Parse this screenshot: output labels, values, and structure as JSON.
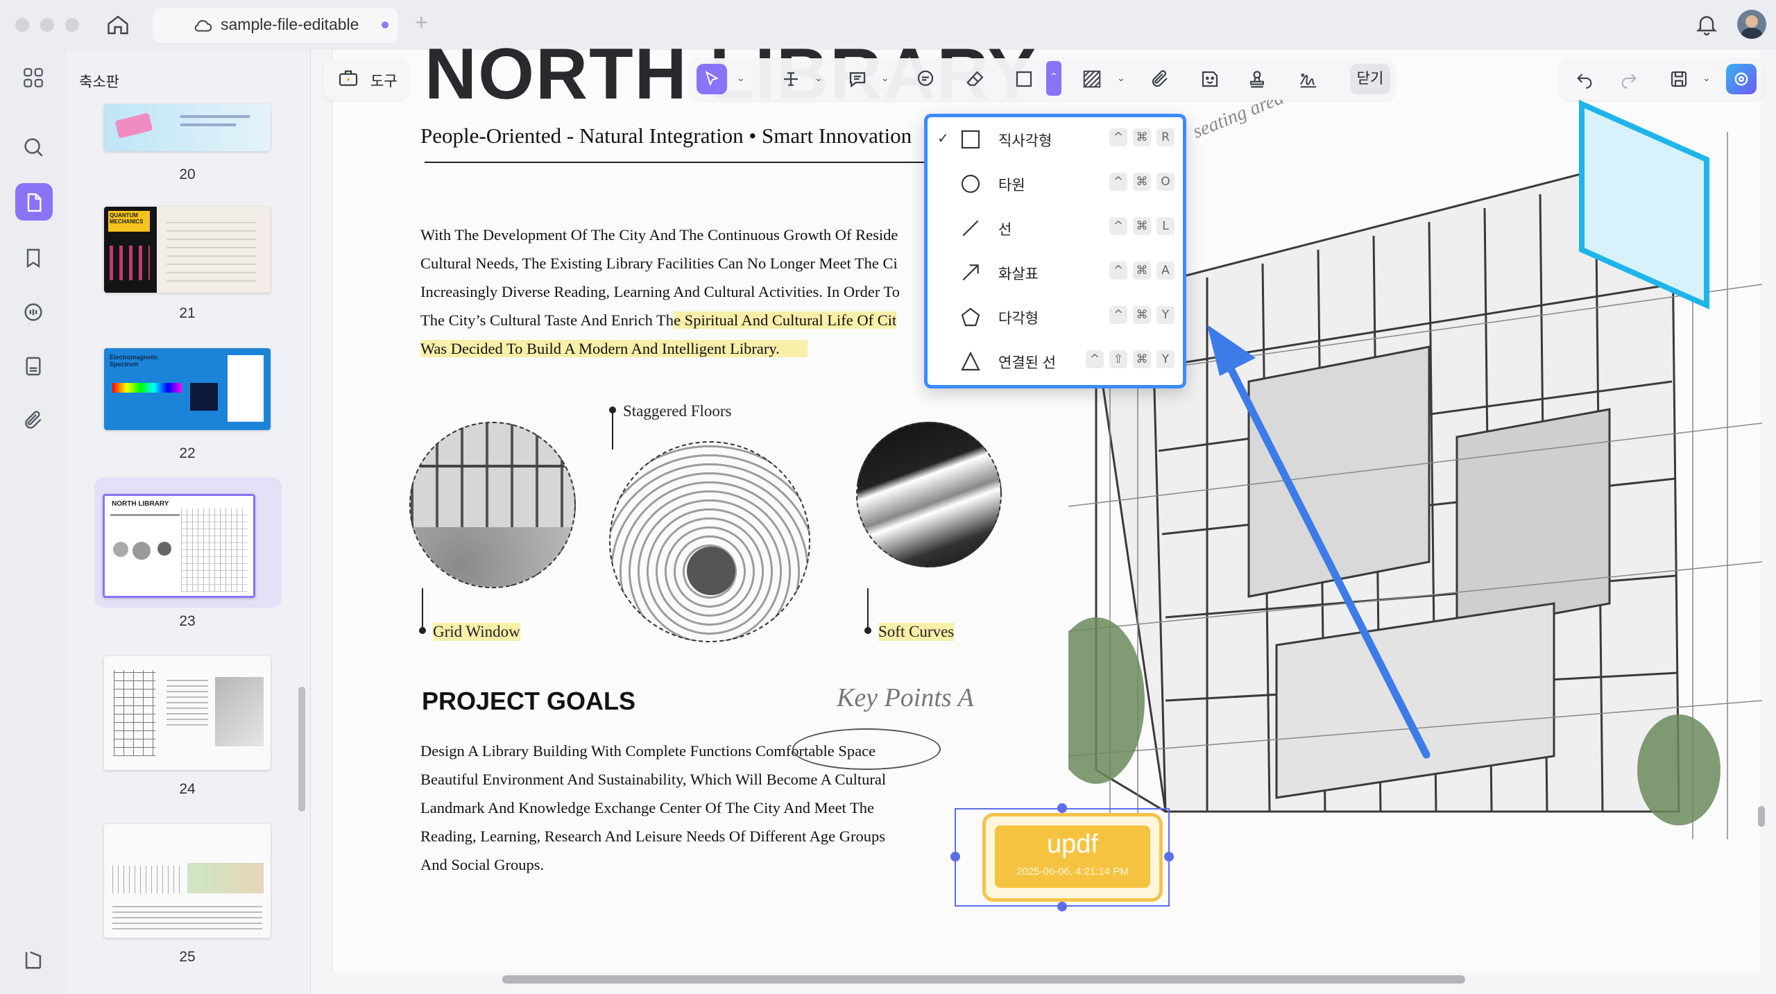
{
  "window": {
    "tab_title": "sample-file-editable",
    "new_tab": "+"
  },
  "sidebar": {
    "panel_title": "축소판",
    "thumbnails": [
      {
        "page": "20"
      },
      {
        "page": "21",
        "label": "QUANTUM MECHANICS"
      },
      {
        "page": "22",
        "label": "Electromagnetic Spectrum"
      },
      {
        "page": "23",
        "label": "NORTH LIBRARY",
        "selected": true
      },
      {
        "page": "24"
      },
      {
        "page": "25"
      }
    ]
  },
  "toolbar": {
    "tools_label": "도구",
    "close_label": "닫기"
  },
  "shape_menu": {
    "items": [
      {
        "label": "직사각형",
        "keys": [
          "^",
          "⌘",
          "R"
        ],
        "checked": true
      },
      {
        "label": "타원",
        "keys": [
          "^",
          "⌘",
          "O"
        ],
        "checked": false
      },
      {
        "label": "선",
        "keys": [
          "^",
          "⌘",
          "L"
        ],
        "checked": false
      },
      {
        "label": "화살표",
        "keys": [
          "^",
          "⌘",
          "A"
        ],
        "checked": false
      },
      {
        "label": "다각형",
        "keys": [
          "^",
          "⌘",
          "Y"
        ],
        "checked": false
      },
      {
        "label": "연결된 선",
        "keys": [
          "^",
          "⇧",
          "⌘",
          "Y"
        ],
        "checked": false
      }
    ]
  },
  "document": {
    "title": "NORTH LIBRARY",
    "subtitle": "People-Oriented - Natural Integration • Smart Innovation",
    "intro_lines": [
      "With The Development Of The City And The Continuous Growth Of Reside",
      "Cultural Needs, The Existing Library Facilities Can No Longer Meet The Ci",
      "Increasingly Diverse Reading, Learning And Cultural Activities. In Order To",
      "The City’s Cultural Taste And Enrich Th"
    ],
    "intro_hl_1": "e Spiritual And Cultural Life Of Cit",
    "intro_hl_2": "Was Decided To Build A Modern And Intelligent Library.",
    "captions": {
      "staggered": "Staggered Floors",
      "grid": "Grid Window",
      "soft": "Soft Curves"
    },
    "sketch_note": "Key Points A",
    "seating_note": "seating area",
    "goals_title": "PROJECT GOALS",
    "goals_lines": [
      "Design A Library Building With Complete Functions Comfortable Space",
      "Beautiful Environment And Sustainability, Which Will Become A Cultural",
      "Landmark And Knowledge Exchange Center Of The City And Meet The",
      "Reading, Learning, Research And Leisure Needs Of Different Age Groups",
      "And Social Groups."
    ],
    "stamp": {
      "brand": "updf",
      "timestamp": "2025-06-06, 4:21:14 PM"
    }
  },
  "colors": {
    "accent": "#8a73f6",
    "highlight": "#f8efa9",
    "arrow": "#3d7be8",
    "cyan_box": "#1fb5ea",
    "stamp": "#f4c34a"
  }
}
